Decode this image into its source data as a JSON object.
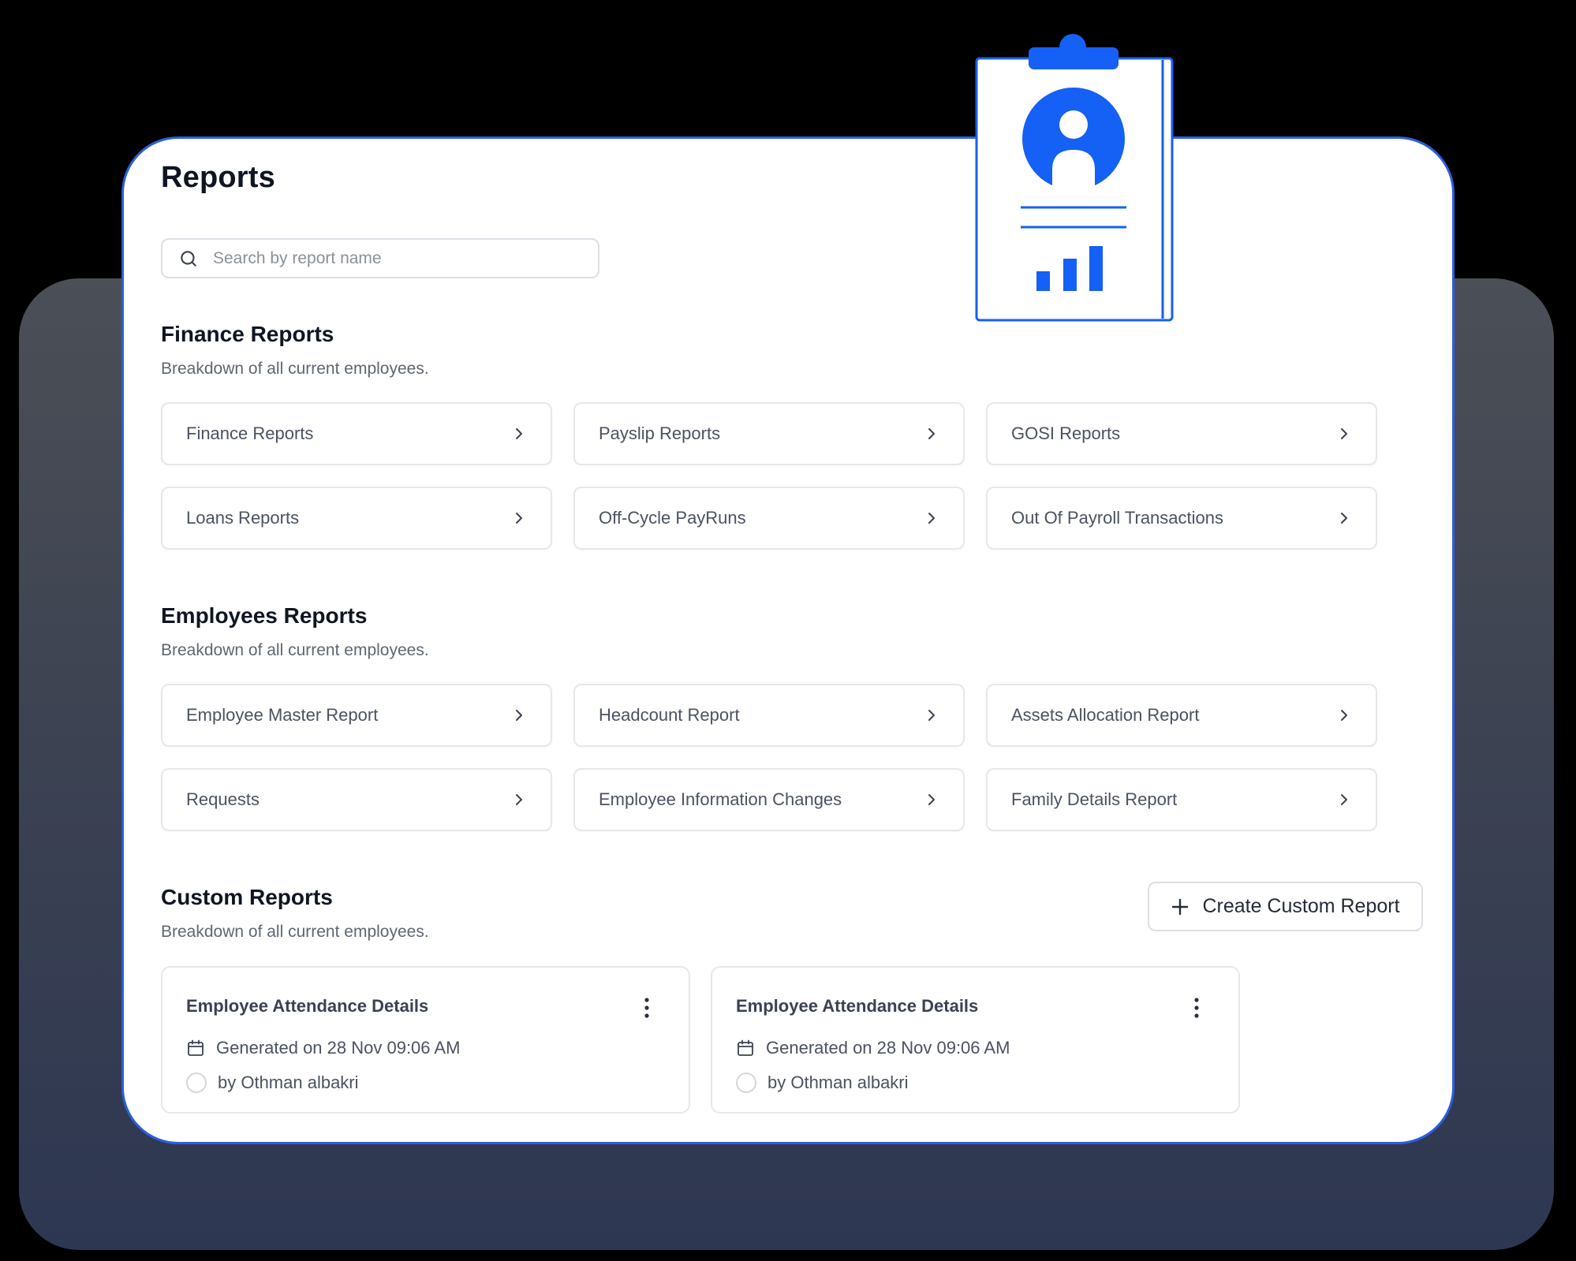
{
  "page": {
    "title": "Reports"
  },
  "search": {
    "placeholder": "Search by report name",
    "value": "",
    "icon": "search-icon"
  },
  "colors": {
    "accent": "#1560f5",
    "panel_border": "#2d5ee0",
    "title_text": "#0f1521",
    "muted_text": "#5f6673",
    "card_text": "#4b5260"
  },
  "sections": {
    "finance": {
      "title": "Finance Reports",
      "subtitle": "Breakdown of all current employees.",
      "items": [
        {
          "label": "Finance Reports"
        },
        {
          "label": "Payslip Reports"
        },
        {
          "label": "GOSI Reports"
        },
        {
          "label": "Loans Reports"
        },
        {
          "label": "Off-Cycle PayRuns"
        },
        {
          "label": "Out Of Payroll Transactions"
        }
      ]
    },
    "employees": {
      "title": "Employees Reports",
      "subtitle": "Breakdown of all current employees.",
      "items": [
        {
          "label": "Employee Master Report"
        },
        {
          "label": "Headcount Report"
        },
        {
          "label": "Assets Allocation Report"
        },
        {
          "label": "Requests"
        },
        {
          "label": "Employee Information Changes"
        },
        {
          "label": "Family Details Report"
        }
      ]
    },
    "custom": {
      "title": "Custom Reports",
      "subtitle": "Breakdown of all current employees.",
      "create_button": "Create Custom Report",
      "items": [
        {
          "title": "Employee Attendance Details",
          "generated": "Generated on 28 Nov 09:06 AM",
          "author": "by Othman albakri"
        },
        {
          "title": "Employee Attendance Details",
          "generated": "Generated on 28 Nov 09:06 AM",
          "author": "by Othman albakri"
        }
      ]
    }
  },
  "illustration": {
    "icon": "clipboard-report-icon"
  }
}
